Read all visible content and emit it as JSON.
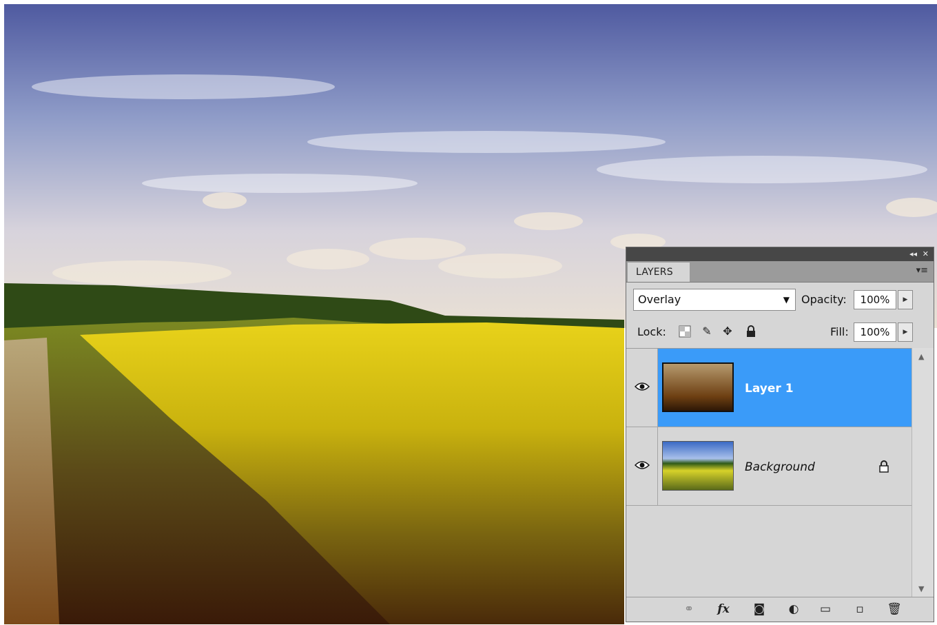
{
  "panel": {
    "collapse_glyph": "◂◂",
    "close_glyph": "✕",
    "tab_label": "LAYERS",
    "menu_glyph": "▾≡",
    "blend_mode": "Overlay",
    "opacity_label": "Opacity:",
    "opacity_value": "100%",
    "lock_label": "Lock:",
    "fill_label": "Fill:",
    "fill_value": "100%",
    "lock_icons": [
      "lock-transparent-icon",
      "lock-image-icon",
      "lock-position-icon",
      "lock-all-icon"
    ]
  },
  "layers": [
    {
      "name": "Layer 1",
      "visible": true,
      "selected": true,
      "locked": false
    },
    {
      "name": "Background",
      "visible": true,
      "selected": false,
      "locked": true
    }
  ],
  "bottom_icons": [
    "link-layers-icon",
    "fx-icon",
    "add-mask-icon",
    "adjustment-layer-icon",
    "new-group-icon",
    "new-layer-icon",
    "delete-layer-icon"
  ],
  "colors": {
    "selection": "#3a9bf9",
    "panel_bg": "#d6d6d6",
    "topbar": "#474747"
  }
}
